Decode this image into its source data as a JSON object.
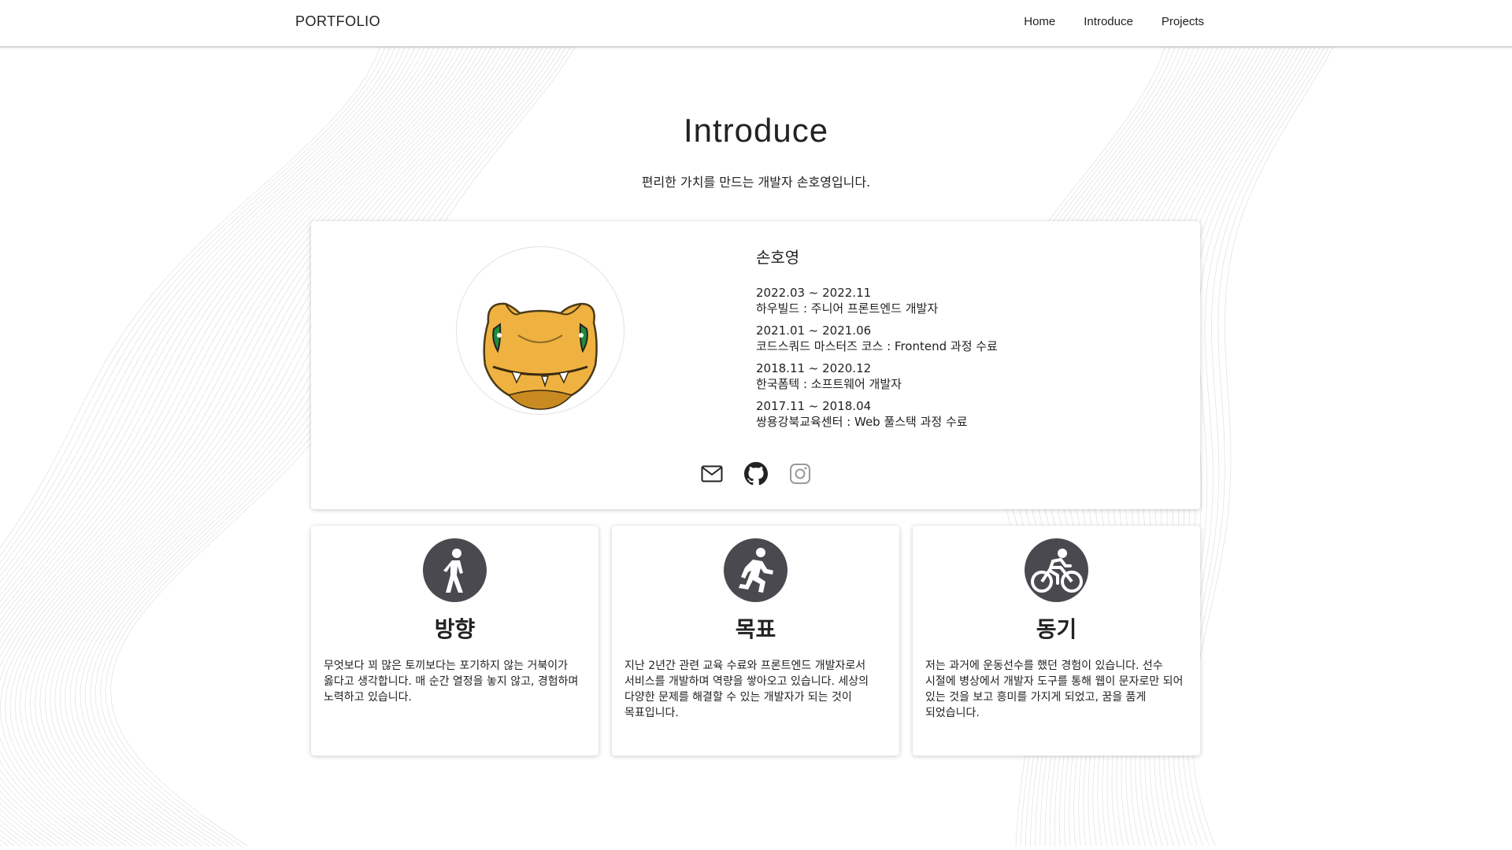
{
  "nav": {
    "brand": "PORTFOLIO",
    "links": [
      "Home",
      "Introduce",
      "Projects"
    ]
  },
  "page": {
    "title": "Introduce",
    "subtitle": "편리한 가치를 만드는 개발자 손호영입니다."
  },
  "profile": {
    "name": "손호영",
    "career": [
      {
        "period": "2022.03 ~ 2022.11",
        "desc": "하우빌드 : 주니어 프론트엔드 개발자"
      },
      {
        "period": "2021.01 ~ 2021.06",
        "desc": "코드스쿼드 마스터즈 코스 : Frontend 과정 수료"
      },
      {
        "period": "2018.11 ~ 2020.12",
        "desc": "한국폼텍 : 소프트웨어 개발자"
      },
      {
        "period": "2017.11 ~ 2018.04",
        "desc": "쌍용강북교육센터 : Web 풀스택 과정 수료"
      }
    ],
    "social": [
      "mail-icon",
      "github-icon",
      "instagram-icon"
    ]
  },
  "values": [
    {
      "icon": "walking-person-icon",
      "title": "방향",
      "text": "무엇보다 꾀 많은 토끼보다는 포기하지 않는 거북이가 옳다고 생각합니다. 매 순간 열정을 놓지 않고, 경험하며 노력하고 있습니다."
    },
    {
      "icon": "running-person-icon",
      "title": "목표",
      "text": "지난 2년간 관련 교육 수료와 프론트엔드 개발자로서 서비스를 개발하며 역량을 쌓아오고 있습니다. 세상의 다양한 문제를 해결할 수 있는 개발자가 되는 것이 목표입니다."
    },
    {
      "icon": "cyclist-icon",
      "title": "동기",
      "text": "저는 과거에 운동선수를 했던 경험이 있습니다. 선수 시절에 병상에서 개발자 도구를 통해 웹이 문자로만 되어 있는 것을 보고 흥미를 가지게 되었고, 꿈을 품게 되었습니다."
    }
  ],
  "colors": {
    "icon_circle": "#4a4950",
    "wave_line": "#e4e4e4",
    "text": "#222222"
  }
}
